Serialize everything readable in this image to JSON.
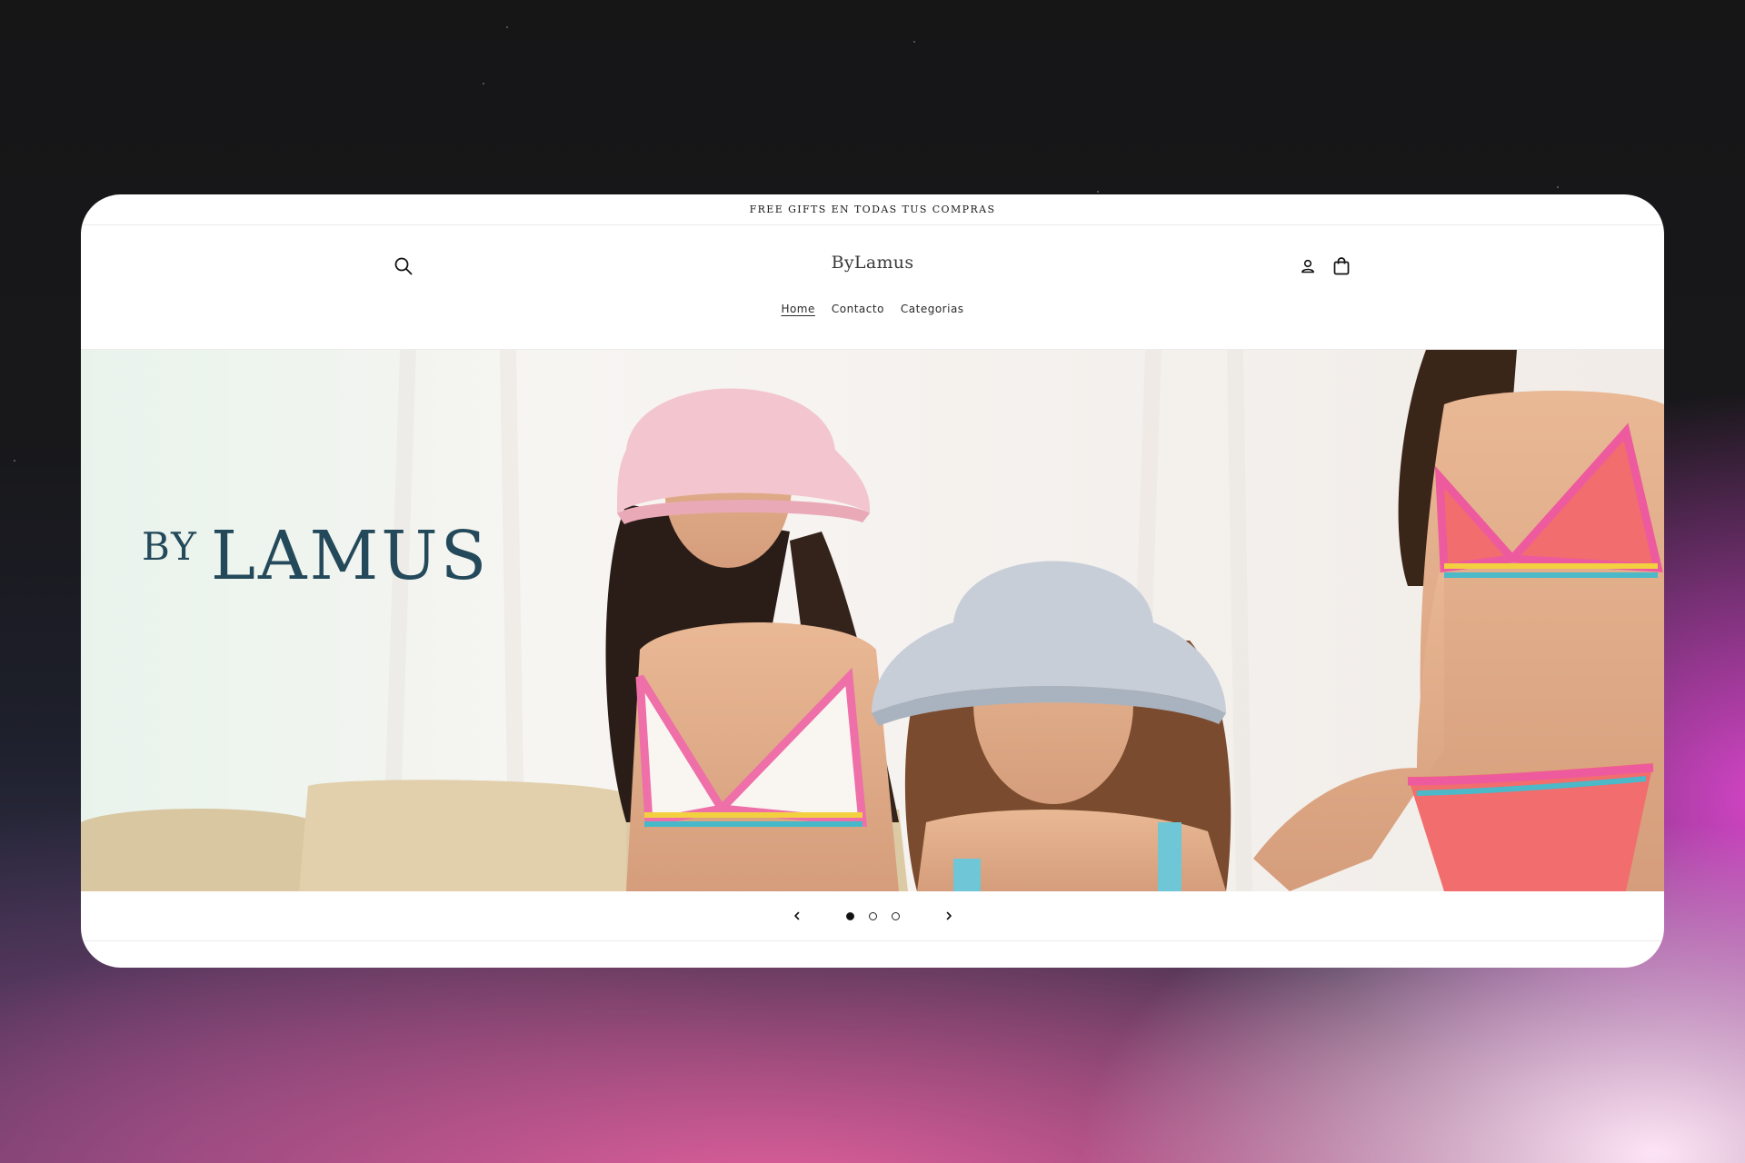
{
  "announcement": "FREE GIFTS EN TODAS TUS COMPRAS",
  "header": {
    "brand": "ByLamus",
    "icons": {
      "search": "search-icon",
      "account": "user-icon",
      "cart": "shopping-bag-icon"
    }
  },
  "nav": [
    {
      "label": "Home",
      "active": true
    },
    {
      "label": "Contacto",
      "active": false
    },
    {
      "label": "Categorias",
      "active": false
    }
  ],
  "hero": {
    "logo_prefix": "BY",
    "logo_main": "LAMUS",
    "logo_color": "#24495a"
  },
  "slideshow": {
    "slides_total": 3,
    "active_slide": 1,
    "prev_icon": "chevron-left-icon",
    "next_icon": "chevron-right-icon"
  }
}
